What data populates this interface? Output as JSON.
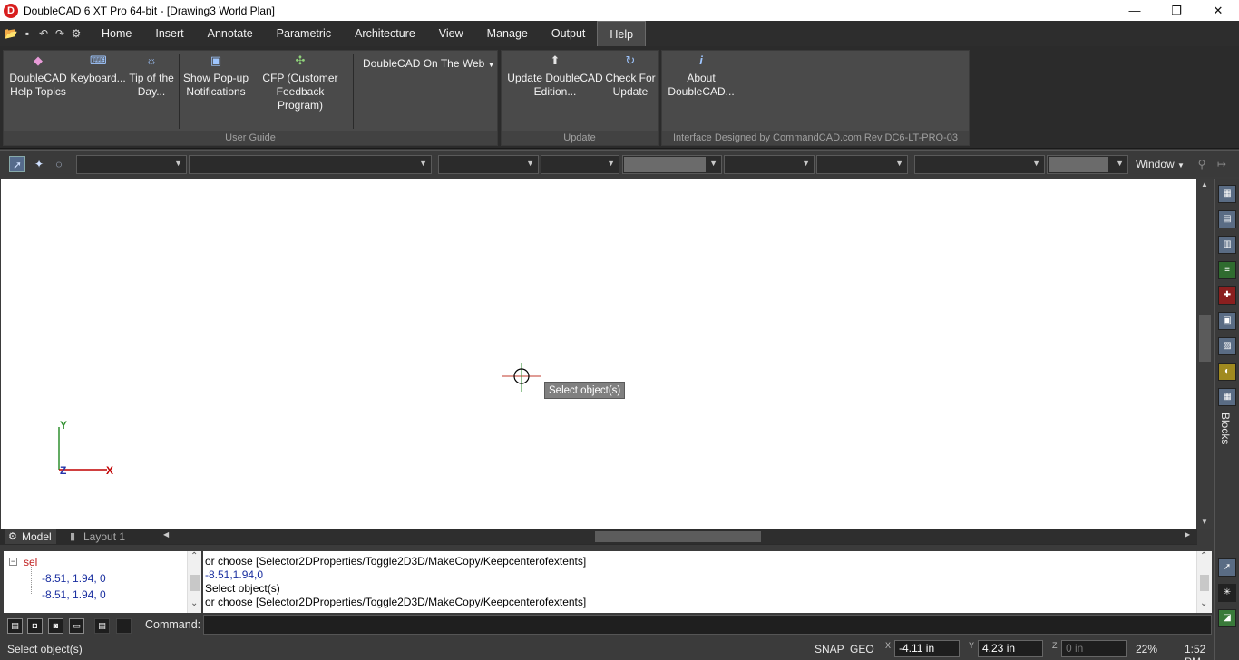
{
  "window": {
    "title": "DoubleCAD 6 XT Pro 64-bit - [Drawing3 World Plan]",
    "logo_letter": "D",
    "minimize": "—",
    "restore": "❐",
    "close": "✕"
  },
  "menu": {
    "tabs": [
      "Home",
      "Insert",
      "Annotate",
      "Parametric",
      "Architecture",
      "View",
      "Manage",
      "Output",
      "Help"
    ],
    "active_tab": "Help",
    "qat_icons": [
      "open-icon",
      "save-icon",
      "undo-icon",
      "redo-icon",
      "settings-icon"
    ]
  },
  "ribbon": {
    "user_guide": {
      "name": "User Guide",
      "buttons": [
        {
          "line1": "DoubleCAD",
          "line2": "Help Topics",
          "icon": "help-book-icon"
        },
        {
          "line1": "Keyboard...",
          "line2": "",
          "icon": "keyboard-icon"
        },
        {
          "line1": "Tip of the",
          "line2": "Day...",
          "icon": "lightbulb-icon"
        },
        {
          "line1": "Show Pop-up",
          "line2": "Notifications",
          "icon": "popup-icon"
        },
        {
          "line1": "CFP (Customer",
          "line2": "Feedback Program)",
          "icon": "feedback-icon"
        }
      ],
      "web_dropdown": "DoubleCAD On The Web"
    },
    "update": {
      "name": "Update",
      "buttons": [
        {
          "line1": "Update DoubleCAD",
          "line2": "Edition...",
          "icon": "upload-icon"
        },
        {
          "line1": "Check For",
          "line2": "Update",
          "icon": "refresh-icon"
        }
      ]
    },
    "about": {
      "name": "Interface Designed by CommandCAD.com Rev DC6-LT-PRO-03",
      "button": {
        "line1": "About",
        "line2": "DoubleCAD...",
        "icon": "info-icon"
      }
    }
  },
  "toolbar": {
    "window_label": "Window"
  },
  "canvas": {
    "tooltip": "Select object(s)",
    "ucs": {
      "y": "Y",
      "z": "Z",
      "x": "X"
    }
  },
  "layout_tabs": {
    "model": "Model",
    "layout1": "Layout 1"
  },
  "tree": {
    "root": "sel",
    "items": [
      "-8.51, 1.94, 0",
      "-8.51, 1.94, 0"
    ]
  },
  "history": {
    "lines": [
      "  or choose [Selector2DProperties/Toggle2D3D/MakeCopy/Keepcenterofextents]",
      "-8.51,1.94,0",
      "Select object(s)",
      "  or choose [Selector2DProperties/Toggle2D3D/MakeCopy/Keepcenterofextents]"
    ]
  },
  "command": {
    "label": "Command:",
    "value": ""
  },
  "status": {
    "prompt": "Select object(s)",
    "snap": "SNAP",
    "geo": "GEO",
    "x_label": "X",
    "x_value": "-4.11 in",
    "y_label": "Y",
    "y_value": "4.23 in",
    "z_label": "Z",
    "z_value": "0 in",
    "zoom": "22%",
    "time": "1:52 PM"
  },
  "right_dock": {
    "label": "Blocks"
  },
  "colors": {
    "accent": "#9fc6ff",
    "canvas": "#ffffff",
    "ucs_x": "#c00000",
    "ucs_y": "#2f8f2f",
    "ucs_z": "#2233aa"
  }
}
